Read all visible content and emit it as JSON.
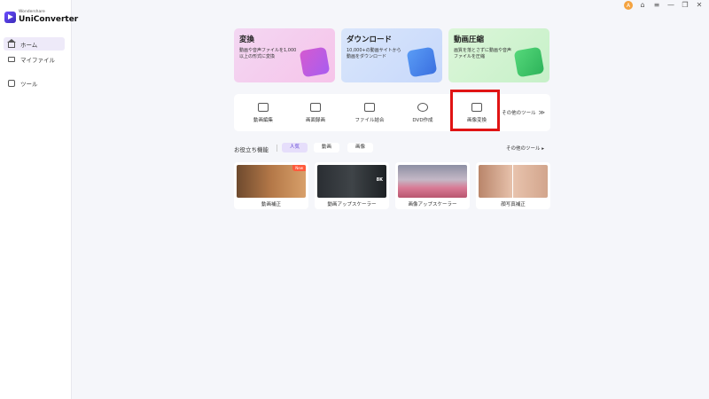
{
  "app": {
    "brand_small": "Wondershare",
    "brand_name": "UniConverter"
  },
  "titlebar": {
    "avatar_letter": "A",
    "controls": [
      "⌂",
      "≡",
      "—",
      "❐",
      "✕"
    ]
  },
  "sidebar": {
    "items": [
      {
        "label": "ホーム",
        "icon": "home-icon",
        "active": true
      },
      {
        "label": "マイファイル",
        "icon": "folder-icon",
        "active": false
      },
      {
        "label": "ツール",
        "icon": "toolbox-icon",
        "active": false
      }
    ]
  },
  "features": [
    {
      "title": "変換",
      "desc": "動画や音声ファイルを1,000以上の形式に変換",
      "color": "#f6c4ea"
    },
    {
      "title": "ダウンロード",
      "desc": "10,000+の動画サイトから動画をダウンロード",
      "color": "#c7d8fb"
    },
    {
      "title": "動画圧縮",
      "desc": "画質を落とさずに動画や音声ファイルを圧縮",
      "color": "#c6f0c8"
    }
  ],
  "tools": {
    "items": [
      {
        "label": "動画編集",
        "icon": "video-edit-icon"
      },
      {
        "label": "画面録画",
        "icon": "screen-record-icon"
      },
      {
        "label": "ファイル結合",
        "icon": "file-merge-icon"
      },
      {
        "label": "DVD作成",
        "icon": "dvd-icon"
      },
      {
        "label": "画像変換",
        "icon": "image-convert-icon"
      }
    ],
    "more_label": "その他のツール",
    "more_chevron": "≫"
  },
  "useful": {
    "title": "お役立ち機能",
    "chips": [
      {
        "label": "人気",
        "active": true
      },
      {
        "label": "動画",
        "active": false
      },
      {
        "label": "画像",
        "active": false
      }
    ],
    "see_more": "その他のツール ▸",
    "cards": [
      {
        "label": "動画補正",
        "badge": "New"
      },
      {
        "label": "動画アップスケーラー",
        "badge": "8K"
      },
      {
        "label": "画像アップスケーラー"
      },
      {
        "label": "顔写真補正"
      }
    ]
  },
  "colors": {
    "accent": "#5a3fd1",
    "highlight": "#e01414",
    "sidebar_active": "#eeeaf9"
  }
}
